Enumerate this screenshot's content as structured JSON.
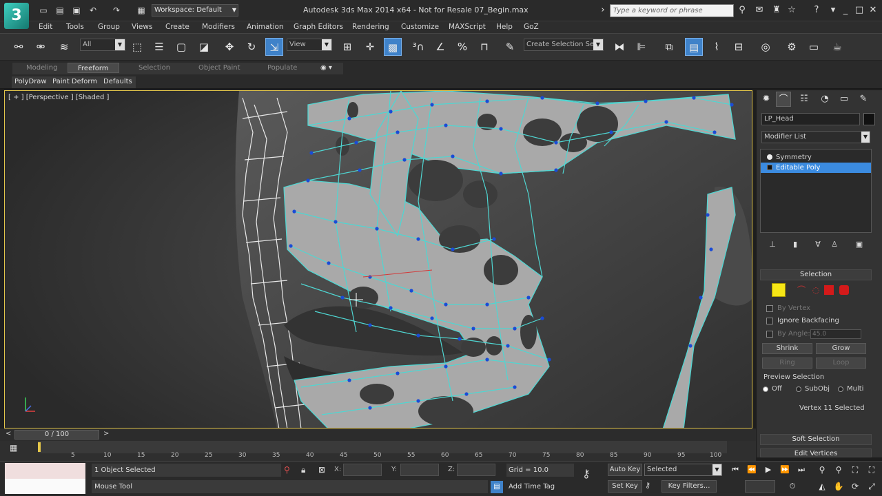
{
  "titlebar": {
    "title": "Autodesk 3ds Max  2014 x64  - Not for Resale   07_Begin.max",
    "workspace": "Workspace: Default",
    "search_placeholder": "Type a keyword or phrase"
  },
  "menu": [
    "Edit",
    "Tools",
    "Group",
    "Views",
    "Create",
    "Modifiers",
    "Animation",
    "Graph Editors",
    "Rendering",
    "Customize",
    "MAXScript",
    "Help",
    "GoZ"
  ],
  "toolbar": {
    "filter": "All",
    "reference_coord": "View",
    "named_selection": "Create Selection Se"
  },
  "ribbon": {
    "tabs": [
      "Modeling",
      "Freeform",
      "Selection",
      "Object Paint",
      "Populate"
    ],
    "active_tab": "Freeform",
    "subtabs": [
      "PolyDraw",
      "Paint Deform",
      "Defaults"
    ]
  },
  "viewport": {
    "label": "[ + ] [Perspective ] [Shaded ]"
  },
  "command_panel": {
    "object_name": "LP_Head",
    "modifier_list": "Modifier List",
    "stack": [
      "Symmetry",
      "Editable Poly"
    ],
    "selection_rollout": "Selection",
    "by_vertex": "By Vertex",
    "ignore_backfacing": "Ignore Backfacing",
    "by_angle": "By Angle:",
    "angle_value": "45.0",
    "shrink": "Shrink",
    "grow": "Grow",
    "ring": "Ring",
    "loop": "Loop",
    "preview_selection": "Preview Selection",
    "preview_off": "Off",
    "preview_subobj": "SubObj",
    "preview_multi": "Multi",
    "vertex_selected": "Vertex 11 Selected",
    "soft_selection": "Soft Selection",
    "edit_vertices": "Edit Vertices"
  },
  "timeline": {
    "slider": "0 / 100",
    "ticks": [
      "5",
      "10",
      "15",
      "20",
      "25",
      "30",
      "35",
      "40",
      "45",
      "50",
      "55",
      "60",
      "65",
      "70",
      "75",
      "80",
      "85",
      "90",
      "95",
      "100"
    ]
  },
  "status": {
    "objects_selected": "1 Object Selected",
    "prompt": "Mouse Tool",
    "x_label": "X:",
    "y_label": "Y:",
    "z_label": "Z:",
    "grid": "Grid = 10.0",
    "add_time_tag": "Add Time Tag",
    "auto_key": "Auto Key",
    "set_key": "Set Key",
    "selected": "Selected",
    "key_filters": "Key Filters..."
  },
  "colors": {
    "viewport_border": "#e2c54b",
    "mesh_wire": "#4fd6d2",
    "vertex": "#1a4bd6",
    "stack_selection": "#3b8be0",
    "active_tool": "#3f82c9"
  }
}
